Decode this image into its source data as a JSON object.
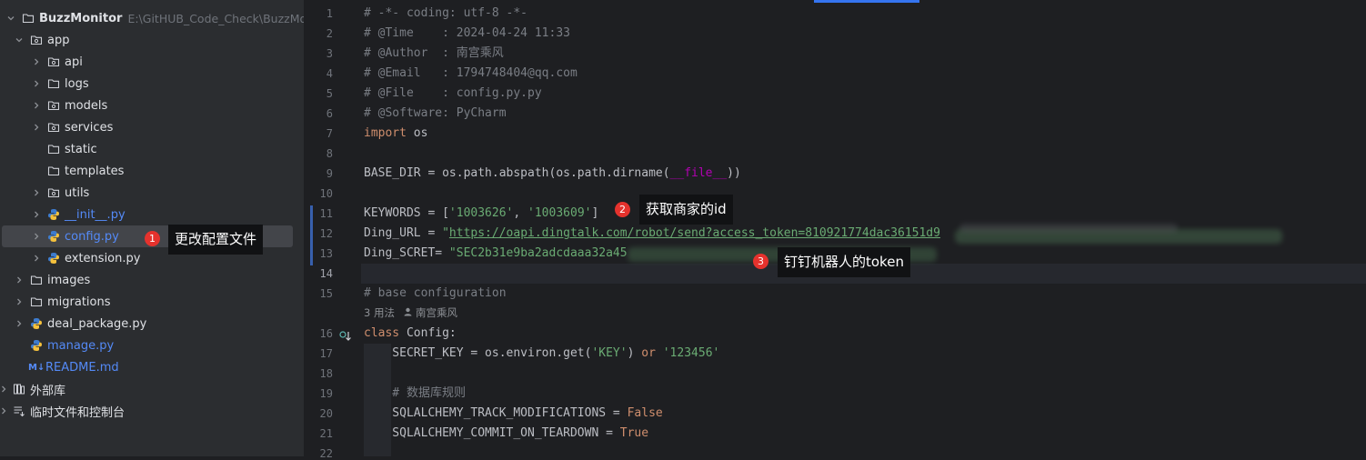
{
  "project_tree": {
    "root": {
      "name": "BuzzMonitor",
      "path": "E:\\GitHUB_Code_Check\\BuzzMonitor"
    },
    "app_folder": "app",
    "app_children": [
      {
        "name": "api",
        "icon": "package-folder-icon",
        "expandable": true
      },
      {
        "name": "logs",
        "icon": "folder-icon",
        "expandable": true
      },
      {
        "name": "models",
        "icon": "package-folder-icon",
        "expandable": true
      },
      {
        "name": "services",
        "icon": "package-folder-icon",
        "expandable": true
      },
      {
        "name": "static",
        "icon": "folder-icon",
        "expandable": false
      },
      {
        "name": "templates",
        "icon": "folder-icon",
        "expandable": false
      },
      {
        "name": "utils",
        "icon": "package-folder-icon",
        "expandable": true
      },
      {
        "name": "__init__.py",
        "icon": "python-file-icon",
        "expandable": true
      },
      {
        "name": "config.py",
        "icon": "python-file-icon",
        "expandable": true,
        "selected": true
      },
      {
        "name": "extension.py",
        "icon": "python-file-icon",
        "expandable": true
      }
    ],
    "root_children": [
      {
        "name": "images",
        "icon": "folder-icon",
        "expandable": true
      },
      {
        "name": "migrations",
        "icon": "folder-icon",
        "expandable": true
      },
      {
        "name": "deal_package.py",
        "icon": "python-file-icon",
        "expandable": true
      },
      {
        "name": "manage.py",
        "icon": "python-file-icon",
        "expandable": false
      },
      {
        "name": "README.md",
        "icon": "markdown-file-icon",
        "badge": "M↓",
        "expandable": false
      }
    ],
    "external_libraries": "外部库",
    "scratches": "临时文件和控制台"
  },
  "editor": {
    "line_numbers": [
      "1",
      "2",
      "3",
      "4",
      "5",
      "6",
      "7",
      "8",
      "9",
      "10",
      "11",
      "12",
      "13",
      "14",
      "15",
      "16",
      "17",
      "18",
      "19",
      "20",
      "21",
      "22"
    ],
    "current_line": "14",
    "lines": {
      "l1": "# -*- coding: utf-8 -*-",
      "l2": "# @Time    : 2024-04-24 11:33",
      "l3": "# @Author  : 南宫乘风",
      "l4": "# @Email   : 1794748404@qq.com",
      "l5": "# @File    : config.py.py",
      "l6": "# @Software: PyCharm",
      "l7_kw": "import",
      "l7_rest": " os",
      "l9_a": "BASE_DIR = os.path.abspath(os.path.dirname(",
      "l9_dunder": "__file__",
      "l9_b": "))",
      "l11_a": "KEYWORDS = [",
      "l11_s1": "'1003626'",
      "l11_sep": ", ",
      "l11_s2": "'1003609'",
      "l11_b": "]",
      "l12_a": "Ding_URL = ",
      "l12_q": "\"",
      "l12_url": "https://oapi.dingtalk.com/robot/send?access_token=810921774dac36151d9",
      "l13_a": "Ding_SCRET= ",
      "l13_str": "\"SEC2b31e9ba2adcdaaa32a45",
      "l15": "# base configuration",
      "l16_kw": "class",
      "l16_rest": " Config:",
      "l17_a": "    SECRET_KEY = os.environ.get(",
      "l17_s1": "'KEY'",
      "l17_b": ") ",
      "l17_or": "or",
      "l17_sp": " ",
      "l17_s2": "'123456'",
      "l19": "    # 数据库规则",
      "l20_a": "    SQLALCHEMY_TRACK_MODIFICATIONS = ",
      "l20_kw": "False",
      "l21_a": "    SQLALCHEMY_COMMIT_ON_TEARDOWN = ",
      "l21_kw": "True"
    },
    "inlay_usages": "3 用法",
    "inlay_author": "南宫乘风"
  },
  "annotations": [
    {
      "number": "1",
      "text": "更改配置文件"
    },
    {
      "number": "2",
      "text": "获取商家的id"
    },
    {
      "number": "3",
      "text": "钉钉机器人的token"
    }
  ],
  "colors": {
    "accent": "#3574f0",
    "badge": "#e5322d",
    "string": "#6aab73",
    "keyword": "#cf8e6d",
    "comment": "#7a7e85"
  }
}
